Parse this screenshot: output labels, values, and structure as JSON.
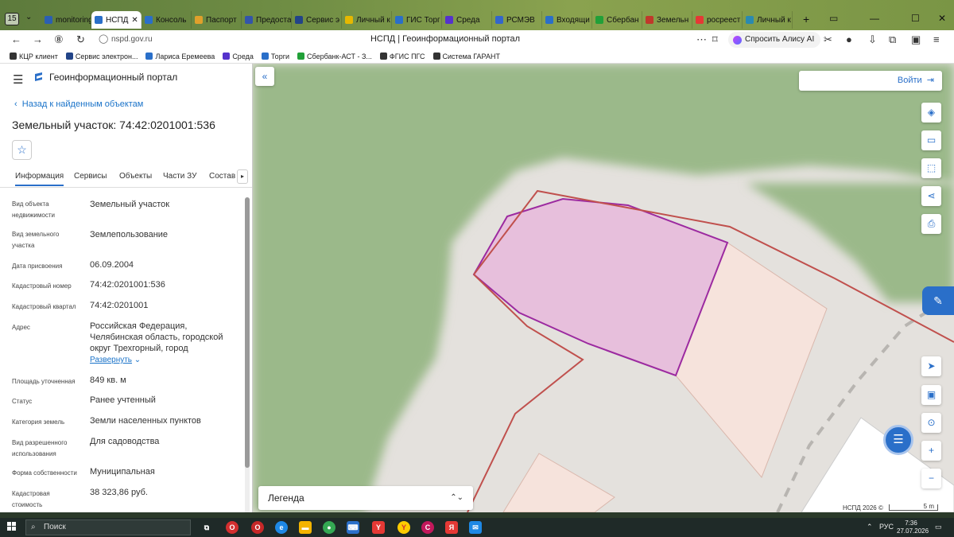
{
  "browser": {
    "tab_counter": "15",
    "tabs": [
      {
        "label": "monitoring",
        "color": "#2b5fb3"
      },
      {
        "label": "НСПД",
        "color": "#2a6fc9"
      },
      {
        "label": "Консоль",
        "color": "#2a6fc9"
      },
      {
        "label": "Паспорт",
        "color": "#e0a02b"
      },
      {
        "label": "Предоста",
        "color": "#3355aa"
      },
      {
        "label": "Сервис э",
        "color": "#224488"
      },
      {
        "label": "Личный к",
        "color": "#e6b800"
      },
      {
        "label": "ГИС Торг",
        "color": "#2a6fc9"
      },
      {
        "label": "Среда",
        "color": "#5533cc"
      },
      {
        "label": "РСМЭВ",
        "color": "#3366cc"
      },
      {
        "label": "Входящи",
        "color": "#2a6fc9"
      },
      {
        "label": "Сбербан",
        "color": "#21a038"
      },
      {
        "label": "Земельн",
        "color": "#c0392b"
      },
      {
        "label": "росреест",
        "color": "#e53935"
      },
      {
        "label": "Личный к",
        "color": "#2a8ab0"
      }
    ],
    "active_tab_index": 1,
    "url": "nspd.gov.ru",
    "page_title": "НСПД | Геоинформационный портал",
    "alice_label": "Спросить Алису AI",
    "bookmarks": [
      {
        "label": "КЦР клиент",
        "color": "#333333"
      },
      {
        "label": "Сервис электрон...",
        "color": "#224488"
      },
      {
        "label": "Лариса Еремеева",
        "color": "#2a6fc9"
      },
      {
        "label": "Среда",
        "color": "#5533cc"
      },
      {
        "label": "Торги",
        "color": "#2a6fc9"
      },
      {
        "label": "Сбербанк-АСТ - З...",
        "color": "#21a038"
      },
      {
        "label": "ФГИС ПГС",
        "color": "#333333"
      },
      {
        "label": "Система ГАРАНТ",
        "color": "#333333"
      }
    ]
  },
  "panel": {
    "brand": "Геоинформационный портал",
    "back_link": "Назад к найденным объектам",
    "title": "Земельный участок: 74:42:0201001:536",
    "tabs": [
      "Информация",
      "Сервисы",
      "Объекты",
      "Части ЗУ",
      "Состав"
    ],
    "properties": [
      {
        "label": "Вид объекта недвижимости",
        "value": "Земельный участок"
      },
      {
        "label": "Вид земельного участка",
        "value": "Землепользование"
      },
      {
        "label": "Дата присвоения",
        "value": "06.09.2004"
      },
      {
        "label": "Кадастровый номер",
        "value": "74:42:0201001:536"
      },
      {
        "label": "Кадастровый квартал",
        "value": "74:42:0201001"
      },
      {
        "label": "Адрес",
        "value": "Российская Федерация, Челябинская область, городской округ Трехгорный, город"
      },
      {
        "label": "Площадь уточненная",
        "value": "849 кв. м"
      },
      {
        "label": "Статус",
        "value": "Ранее учтенный"
      },
      {
        "label": "Категория земель",
        "value": "Земли населенных пунктов"
      },
      {
        "label": "Вид разрешенного использования",
        "value": "Для садоводства"
      },
      {
        "label": "Форма собственности",
        "value": "Муниципальная"
      },
      {
        "label": "Кадастровая стоимость",
        "value": "38 323,86 руб."
      }
    ],
    "expand_label": "Развернуть"
  },
  "map": {
    "login_label": "Войти",
    "legend_label": "Легенда",
    "copyright": "НСПД 2026 ©",
    "scale_label": "5 m",
    "colors": {
      "grass": "#9bb98a",
      "road": "#dcd8d4",
      "selected_fill": "#e7bfdc",
      "selected_stroke": "#9c2aa0",
      "parcel_fill": "#f6e3dc",
      "boundary": "#c0504d",
      "accent": "#2a6fc9"
    }
  },
  "taskbar": {
    "search_label": "Поиск",
    "lang": "РУС",
    "time": "7:36",
    "date": "27.07.2026"
  }
}
